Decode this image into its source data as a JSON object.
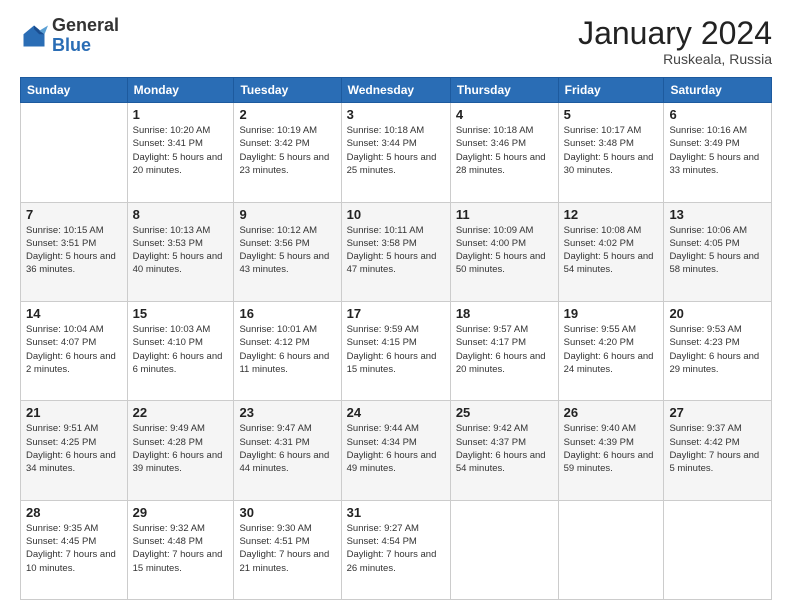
{
  "logo": {
    "general": "General",
    "blue": "Blue"
  },
  "title": "January 2024",
  "location": "Ruskeala, Russia",
  "days_header": [
    "Sunday",
    "Monday",
    "Tuesday",
    "Wednesday",
    "Thursday",
    "Friday",
    "Saturday"
  ],
  "weeks": [
    [
      {
        "day": "",
        "sunrise": "",
        "sunset": "",
        "daylight": ""
      },
      {
        "day": "1",
        "sunrise": "Sunrise: 10:20 AM",
        "sunset": "Sunset: 3:41 PM",
        "daylight": "Daylight: 5 hours and 20 minutes."
      },
      {
        "day": "2",
        "sunrise": "Sunrise: 10:19 AM",
        "sunset": "Sunset: 3:42 PM",
        "daylight": "Daylight: 5 hours and 23 minutes."
      },
      {
        "day": "3",
        "sunrise": "Sunrise: 10:18 AM",
        "sunset": "Sunset: 3:44 PM",
        "daylight": "Daylight: 5 hours and 25 minutes."
      },
      {
        "day": "4",
        "sunrise": "Sunrise: 10:18 AM",
        "sunset": "Sunset: 3:46 PM",
        "daylight": "Daylight: 5 hours and 28 minutes."
      },
      {
        "day": "5",
        "sunrise": "Sunrise: 10:17 AM",
        "sunset": "Sunset: 3:48 PM",
        "daylight": "Daylight: 5 hours and 30 minutes."
      },
      {
        "day": "6",
        "sunrise": "Sunrise: 10:16 AM",
        "sunset": "Sunset: 3:49 PM",
        "daylight": "Daylight: 5 hours and 33 minutes."
      }
    ],
    [
      {
        "day": "7",
        "sunrise": "Sunrise: 10:15 AM",
        "sunset": "Sunset: 3:51 PM",
        "daylight": "Daylight: 5 hours and 36 minutes."
      },
      {
        "day": "8",
        "sunrise": "Sunrise: 10:13 AM",
        "sunset": "Sunset: 3:53 PM",
        "daylight": "Daylight: 5 hours and 40 minutes."
      },
      {
        "day": "9",
        "sunrise": "Sunrise: 10:12 AM",
        "sunset": "Sunset: 3:56 PM",
        "daylight": "Daylight: 5 hours and 43 minutes."
      },
      {
        "day": "10",
        "sunrise": "Sunrise: 10:11 AM",
        "sunset": "Sunset: 3:58 PM",
        "daylight": "Daylight: 5 hours and 47 minutes."
      },
      {
        "day": "11",
        "sunrise": "Sunrise: 10:09 AM",
        "sunset": "Sunset: 4:00 PM",
        "daylight": "Daylight: 5 hours and 50 minutes."
      },
      {
        "day": "12",
        "sunrise": "Sunrise: 10:08 AM",
        "sunset": "Sunset: 4:02 PM",
        "daylight": "Daylight: 5 hours and 54 minutes."
      },
      {
        "day": "13",
        "sunrise": "Sunrise: 10:06 AM",
        "sunset": "Sunset: 4:05 PM",
        "daylight": "Daylight: 5 hours and 58 minutes."
      }
    ],
    [
      {
        "day": "14",
        "sunrise": "Sunrise: 10:04 AM",
        "sunset": "Sunset: 4:07 PM",
        "daylight": "Daylight: 6 hours and 2 minutes."
      },
      {
        "day": "15",
        "sunrise": "Sunrise: 10:03 AM",
        "sunset": "Sunset: 4:10 PM",
        "daylight": "Daylight: 6 hours and 6 minutes."
      },
      {
        "day": "16",
        "sunrise": "Sunrise: 10:01 AM",
        "sunset": "Sunset: 4:12 PM",
        "daylight": "Daylight: 6 hours and 11 minutes."
      },
      {
        "day": "17",
        "sunrise": "Sunrise: 9:59 AM",
        "sunset": "Sunset: 4:15 PM",
        "daylight": "Daylight: 6 hours and 15 minutes."
      },
      {
        "day": "18",
        "sunrise": "Sunrise: 9:57 AM",
        "sunset": "Sunset: 4:17 PM",
        "daylight": "Daylight: 6 hours and 20 minutes."
      },
      {
        "day": "19",
        "sunrise": "Sunrise: 9:55 AM",
        "sunset": "Sunset: 4:20 PM",
        "daylight": "Daylight: 6 hours and 24 minutes."
      },
      {
        "day": "20",
        "sunrise": "Sunrise: 9:53 AM",
        "sunset": "Sunset: 4:23 PM",
        "daylight": "Daylight: 6 hours and 29 minutes."
      }
    ],
    [
      {
        "day": "21",
        "sunrise": "Sunrise: 9:51 AM",
        "sunset": "Sunset: 4:25 PM",
        "daylight": "Daylight: 6 hours and 34 minutes."
      },
      {
        "day": "22",
        "sunrise": "Sunrise: 9:49 AM",
        "sunset": "Sunset: 4:28 PM",
        "daylight": "Daylight: 6 hours and 39 minutes."
      },
      {
        "day": "23",
        "sunrise": "Sunrise: 9:47 AM",
        "sunset": "Sunset: 4:31 PM",
        "daylight": "Daylight: 6 hours and 44 minutes."
      },
      {
        "day": "24",
        "sunrise": "Sunrise: 9:44 AM",
        "sunset": "Sunset: 4:34 PM",
        "daylight": "Daylight: 6 hours and 49 minutes."
      },
      {
        "day": "25",
        "sunrise": "Sunrise: 9:42 AM",
        "sunset": "Sunset: 4:37 PM",
        "daylight": "Daylight: 6 hours and 54 minutes."
      },
      {
        "day": "26",
        "sunrise": "Sunrise: 9:40 AM",
        "sunset": "Sunset: 4:39 PM",
        "daylight": "Daylight: 6 hours and 59 minutes."
      },
      {
        "day": "27",
        "sunrise": "Sunrise: 9:37 AM",
        "sunset": "Sunset: 4:42 PM",
        "daylight": "Daylight: 7 hours and 5 minutes."
      }
    ],
    [
      {
        "day": "28",
        "sunrise": "Sunrise: 9:35 AM",
        "sunset": "Sunset: 4:45 PM",
        "daylight": "Daylight: 7 hours and 10 minutes."
      },
      {
        "day": "29",
        "sunrise": "Sunrise: 9:32 AM",
        "sunset": "Sunset: 4:48 PM",
        "daylight": "Daylight: 7 hours and 15 minutes."
      },
      {
        "day": "30",
        "sunrise": "Sunrise: 9:30 AM",
        "sunset": "Sunset: 4:51 PM",
        "daylight": "Daylight: 7 hours and 21 minutes."
      },
      {
        "day": "31",
        "sunrise": "Sunrise: 9:27 AM",
        "sunset": "Sunset: 4:54 PM",
        "daylight": "Daylight: 7 hours and 26 minutes."
      },
      {
        "day": "",
        "sunrise": "",
        "sunset": "",
        "daylight": ""
      },
      {
        "day": "",
        "sunrise": "",
        "sunset": "",
        "daylight": ""
      },
      {
        "day": "",
        "sunrise": "",
        "sunset": "",
        "daylight": ""
      }
    ]
  ]
}
